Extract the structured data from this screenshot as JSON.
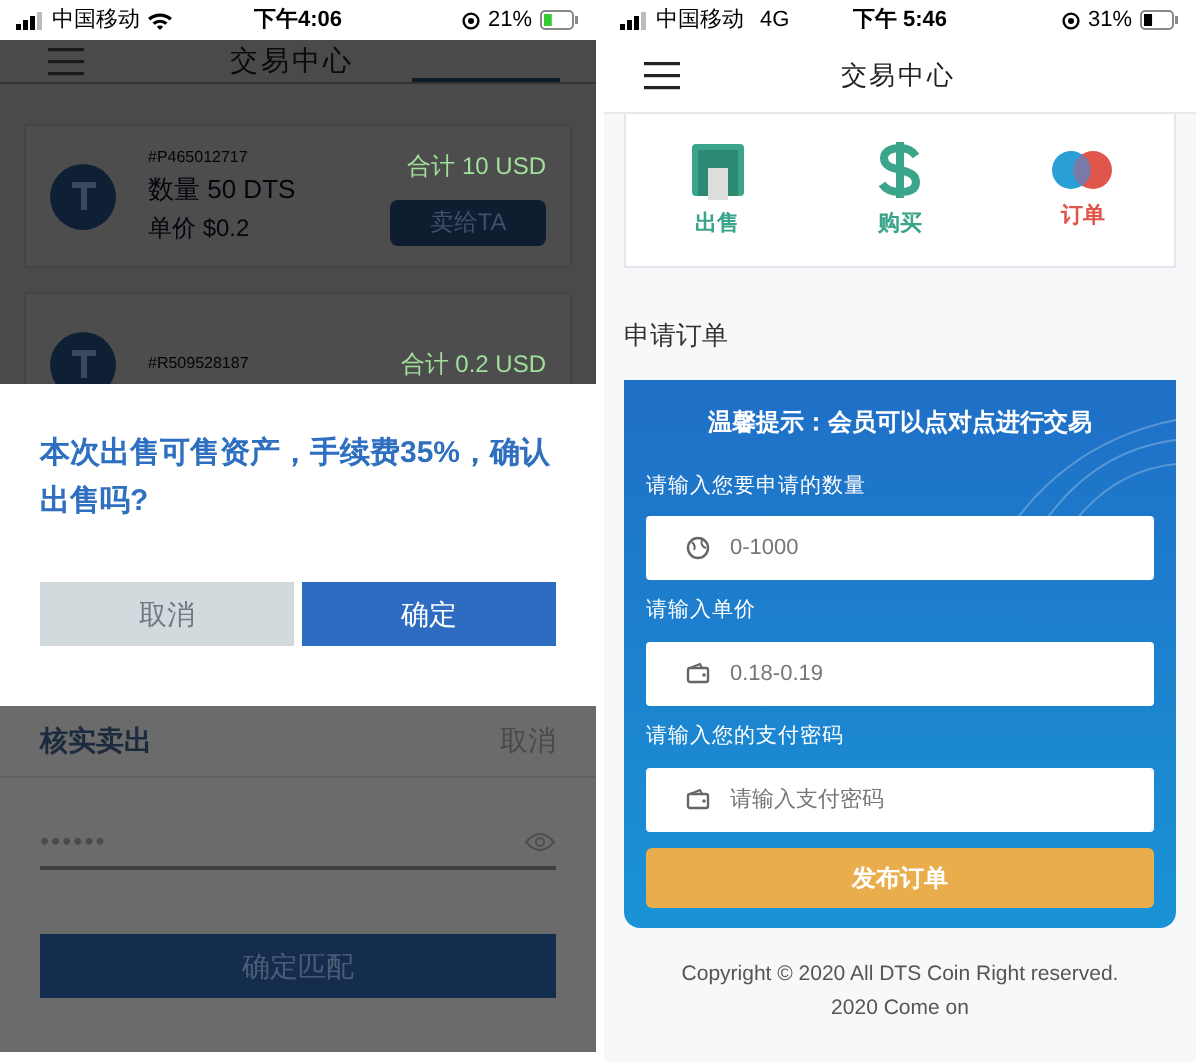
{
  "left_phone": {
    "status_bar": {
      "carrier": "中国移动",
      "time": "下午4:06",
      "battery": "21%"
    },
    "header": {
      "title": "交易中心"
    },
    "orders": [
      {
        "id": "#P465012717",
        "quantity": "数量 50 DTS",
        "price": "单价 $0.2",
        "total": "合计 10 USD",
        "action": "卖给TA"
      },
      {
        "id": "#R509528187",
        "total": "合计 0.2 USD"
      }
    ],
    "dialog": {
      "message": "本次出售可售资产，手续费35%，确认出售吗?",
      "buttons": [
        {
          "label": "取消",
          "kind": "cancel"
        },
        {
          "label": "确定",
          "kind": "confirm"
        }
      ]
    },
    "sheet": {
      "title": "核实卖出",
      "cancel": "取消",
      "password": "••••••",
      "submit": "确定匹配"
    }
  },
  "right_phone": {
    "status_bar": {
      "carrier": "中国移动",
      "network": "4G",
      "time": "下午 5:46",
      "battery": "31%"
    },
    "header": {
      "title": "交易中心"
    },
    "actions": [
      {
        "label": "出售",
        "kind": "sell",
        "color": "#3aa58a"
      },
      {
        "label": "购买",
        "kind": "buy",
        "color": "#3aa58a"
      },
      {
        "label": "订单",
        "kind": "orders",
        "color": "#e0564a"
      }
    ],
    "section_title": "申请订单",
    "form": {
      "notice": "温馨提示：会员可以点对点进行交易",
      "fields": [
        {
          "label": "请输入您要申请的数量",
          "placeholder": "0-1000",
          "kind": "globe"
        },
        {
          "label": "请输入单价",
          "placeholder": "0.18-0.19",
          "kind": "wallet"
        },
        {
          "label": "请输入您的支付密码",
          "placeholder": "请输入支付密码",
          "kind": "wallet"
        }
      ],
      "submit": "发布订单"
    },
    "footer": [
      "Copyright © 2020 All DTS Coin Right reserved.",
      "2020 Come on"
    ]
  }
}
